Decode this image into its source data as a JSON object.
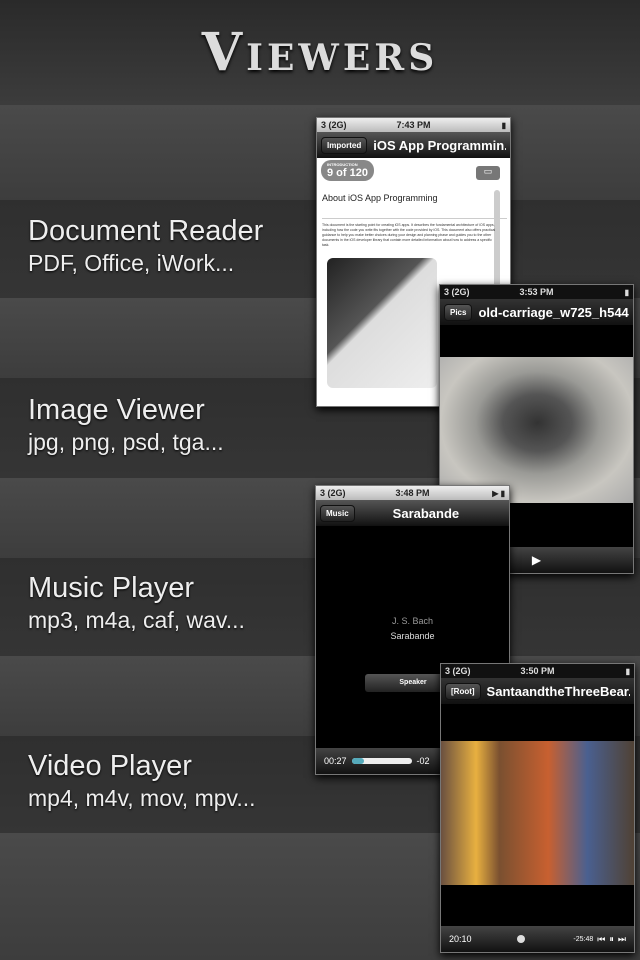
{
  "title": "Viewers",
  "features": [
    {
      "name": "Document Reader",
      "formats": "PDF, Office, iWork..."
    },
    {
      "name": "Image Viewer",
      "formats": "jpg, png, psd, tga..."
    },
    {
      "name": "Music Player",
      "formats": "mp3, m4a, caf, wav..."
    },
    {
      "name": "Video Player",
      "formats": "mp4, m4v, mov, mpv..."
    }
  ],
  "doc": {
    "carrier": "3 (2G)",
    "time": "7:43 PM",
    "back": "Imported",
    "nav_title": "iOS App Programmin...",
    "page": "9 of 120",
    "section": "INTRODUCTION",
    "heading": "About iOS App Programming",
    "body": "This document is the starting point for creating iOS apps. It describes the fundamental architecture of iOS apps, including how the code you write fits together with the code provided by iOS. This document also offers practical guidance to help you make better choices during your design and planning phase and guides you to the other documents in the iOS developer library that contain more detailed information about how to address a specific task."
  },
  "image": {
    "carrier": "3 (2G)",
    "time": "3:53 PM",
    "back": "Pics",
    "nav_title": "old-carriage_w725_h544"
  },
  "music": {
    "carrier": "3 (2G)",
    "time": "3:48 PM",
    "back": "Music",
    "nav_title": "Sarabande",
    "artist": "J. S. Bach",
    "track": "Sarabande",
    "speaker": "Speaker",
    "elapsed": "00:27",
    "remaining": "-02",
    "progress": 0.2
  },
  "video": {
    "carrier": "3 (2G)",
    "time": "3:50 PM",
    "back": "[Root]",
    "nav_title": "SantaandtheThreeBear...",
    "elapsed": "20:10",
    "remaining": "-25:48",
    "progress": 0.44
  }
}
